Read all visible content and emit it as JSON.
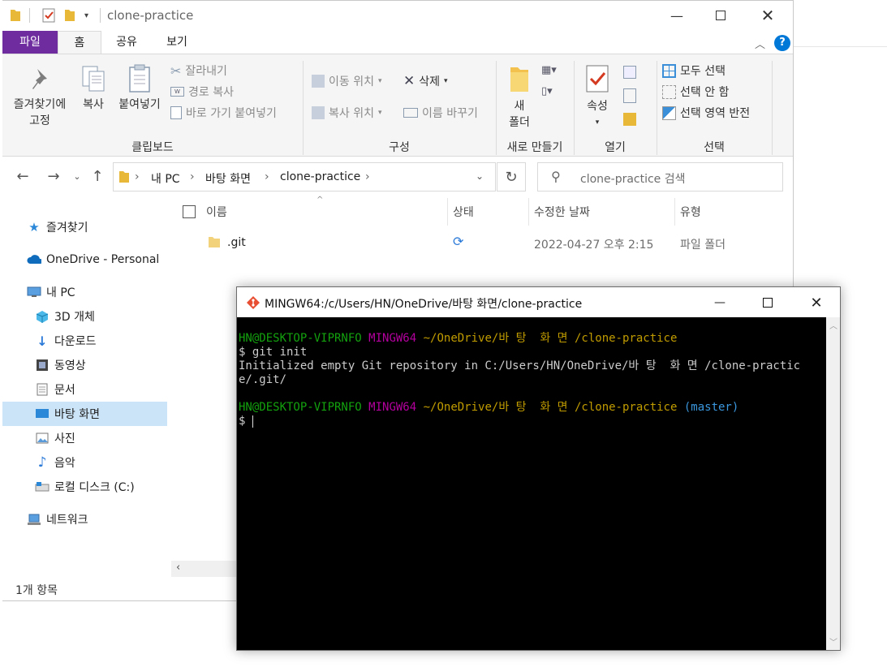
{
  "explorer": {
    "title": "clone-practice",
    "tabs": {
      "file": "파일",
      "home": "홈",
      "share": "공유",
      "view": "보기"
    },
    "ribbon": {
      "clipboard": {
        "pin_line1": "즐겨찾기에",
        "pin_line2": "고정",
        "copy": "복사",
        "paste": "붙여넣기",
        "cut": "잘라내기",
        "copy_path": "경로 복사",
        "paste_shortcut": "바로 가기 붙여넣기",
        "group_label": "클립보드"
      },
      "organize": {
        "move_to": "이동 위치",
        "copy_to": "복사 위치",
        "delete": "삭제",
        "rename": "이름 바꾸기",
        "group_label": "구성"
      },
      "new": {
        "new_folder_line1": "새",
        "new_folder_line2": "폴더",
        "group_label": "새로 만들기"
      },
      "open": {
        "properties": "속성",
        "group_label": "열기"
      },
      "select": {
        "select_all": "모두 선택",
        "select_none": "선택 안 함",
        "invert": "선택 영역 반전",
        "group_label": "선택"
      }
    },
    "address": {
      "crumbs": [
        "내 PC",
        "바탕 화면",
        "clone-practice"
      ],
      "search_placeholder": "clone-practice 검색"
    },
    "sidebar": [
      {
        "label": "즐겨찾기",
        "icon": "star-icon"
      },
      {
        "label": "OneDrive - Personal",
        "icon": "cloud-icon"
      },
      {
        "label": "내 PC",
        "icon": "computer-icon"
      },
      {
        "label": "3D 개체",
        "icon": "cube-icon"
      },
      {
        "label": "다운로드",
        "icon": "download-icon"
      },
      {
        "label": "동영상",
        "icon": "video-icon"
      },
      {
        "label": "문서",
        "icon": "document-icon"
      },
      {
        "label": "바탕 화면",
        "icon": "desktop-icon",
        "selected": true
      },
      {
        "label": "사진",
        "icon": "picture-icon"
      },
      {
        "label": "음악",
        "icon": "music-icon"
      },
      {
        "label": "로컬 디스크 (C:)",
        "icon": "drive-icon"
      },
      {
        "label": "네트워크",
        "icon": "network-icon"
      }
    ],
    "columns": {
      "name": "이름",
      "status": "상태",
      "modified": "수정한 날짜",
      "type": "유형"
    },
    "files": [
      {
        "name": ".git",
        "status_icon": "sync-icon",
        "modified": "2022-04-27 오후 2:15",
        "type": "파일 폴더"
      }
    ],
    "status": "1개 항목",
    "colors": {
      "file_tab": "#6e2c9e",
      "selected": "#cce4f7",
      "accent": "#0078d7"
    }
  },
  "terminal": {
    "title": "MINGW64:/c/Users/HN/OneDrive/바탕 화면/clone-practice",
    "lines": {
      "prompt1_user": "HN@DESKTOP-VIPRNFO",
      "prompt1_env": "MINGW64",
      "prompt1_path": "~/OneDrive/바 탕  화 면 /clone-practice",
      "cmd": "$ git init",
      "output1": "Initialized empty Git repository in C:/Users/HN/OneDrive/바 탕  화 면 /clone-practic",
      "output2": "e/.git/",
      "prompt2_user": "HN@DESKTOP-VIPRNFO",
      "prompt2_env": "MINGW64",
      "prompt2_path": "~/OneDrive/바 탕  화 면 /clone-practice",
      "prompt2_branch": "(master)",
      "cursor_prompt": "$"
    },
    "colors": {
      "user": "#13a10e",
      "env": "#b4009e",
      "path": "#c19c00",
      "branch": "#3a96dd"
    }
  }
}
